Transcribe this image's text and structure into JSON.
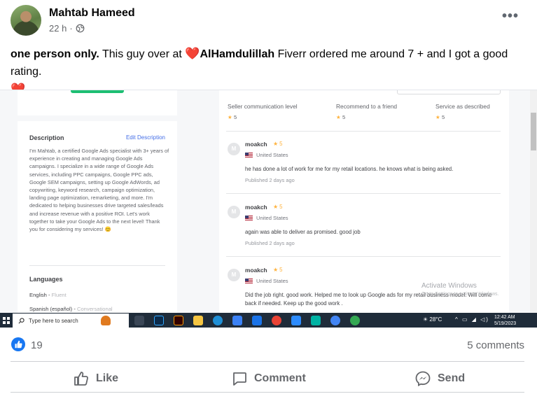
{
  "post": {
    "author": "Mahtab Hameed",
    "time": "22 h",
    "meta_sep": "·",
    "privacy_icon": "globe-icon",
    "more_label": "•••",
    "text_bold": "one person only.",
    "text_part1": " This guy over at ",
    "heart": "❤️",
    "text_bold2": "AlHamdulillah",
    "text_part2": " Fiverr ordered me around 7 + and I got a good rating.",
    "heart2": "❤️"
  },
  "screenshot": {
    "description_title": "Description",
    "edit_description": "Edit Description",
    "description_body": "I'm Mahtab, a certified Google Ads specialist with 3+ years of experience in creating and managing Google Ads campaigns. I specialize in a wide range of Google Ads services, including PPC campaigns, Google PPC ads, Google SEM campaigns, setting up Google AdWords, ad copywriting, keyword research, campaign optimization, landing page optimization, remarketing, and more. I'm dedicated to helping businesses drive targeted sales/leads and increase revenue with a positive ROI. Let's work together to take your Google Ads to the next level! Thank you for considering my services! 😊",
    "languages_title": "Languages",
    "languages": [
      {
        "name": "English",
        "level": "Fluent"
      },
      {
        "name": "Spanish (español)",
        "level": "Conversational"
      }
    ],
    "criteria": [
      {
        "label": "Seller communication level",
        "value": "5"
      },
      {
        "label": "Recommend to a friend",
        "value": "5"
      },
      {
        "label": "Service as described",
        "value": "5"
      }
    ],
    "reviews": [
      {
        "initial": "M",
        "name": "moakch",
        "rating": "5",
        "country": "United States",
        "text": "he has done a lot of work for me for my retail locations. he knows what is being asked.",
        "date": "Published 2 days ago"
      },
      {
        "initial": "M",
        "name": "moakch",
        "rating": "5",
        "country": "United States",
        "text": "again was able to deliver as promised. good job",
        "date": "Published 2 days ago"
      },
      {
        "initial": "M",
        "name": "moakch",
        "rating": "5",
        "country": "United States",
        "text": "Did the job right. good work. Helped me to look up Google ads for my retail business model. Will come back if needed. Keep up the good work .",
        "date": ""
      }
    ],
    "watermark_line1": "Activate Windows",
    "watermark_line2": "Go to Settings to activate Windows.",
    "taskbar": {
      "search_placeholder": "Type here to search",
      "weather": "28°C",
      "time": "12:42 AM",
      "date": "5/19/2023"
    }
  },
  "footer": {
    "reaction_count": "19",
    "comments": "5 comments",
    "like_label": "Like",
    "comment_label": "Comment",
    "send_label": "Send"
  },
  "colors": {
    "facebook_blue": "#1877f2",
    "fiverr_green": "#1dbf73",
    "star": "#ffb33e",
    "heart": "#e41e3f"
  }
}
